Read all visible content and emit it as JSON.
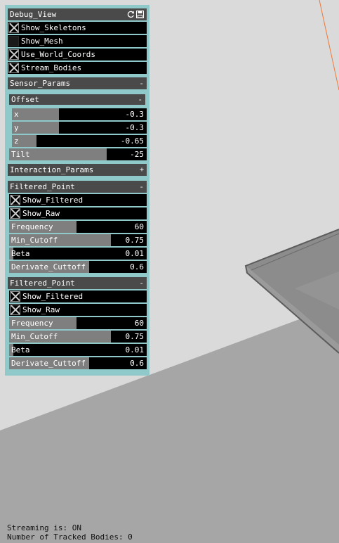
{
  "debug_view": {
    "title": "Debug_View",
    "icons": [
      "refresh-icon",
      "save-icon"
    ],
    "toggles": [
      {
        "label": "Show_Skeletons",
        "checked": true
      },
      {
        "label": "Show_Mesh",
        "checked": false
      },
      {
        "label": "Use_World_Coords",
        "checked": true
      },
      {
        "label": "Stream_Bodies",
        "checked": true
      }
    ]
  },
  "sensor_params": {
    "title": "Sensor_Params",
    "collapse": "-",
    "offset": {
      "title": "Offset",
      "collapse": "-",
      "sliders": [
        {
          "label": "x",
          "value": "-0.3",
          "fraction": 0.35
        },
        {
          "label": "y",
          "value": "-0.3",
          "fraction": 0.35
        },
        {
          "label": "z",
          "value": "-0.65",
          "fraction": 0.18
        }
      ]
    },
    "tilt": {
      "label": "Tilt",
      "value": "-25",
      "fraction": 0.71
    }
  },
  "interaction_params": {
    "title": "Interaction_Params",
    "collapse": "+"
  },
  "filtered_points": [
    {
      "title": "Filtered_Point",
      "collapse": "-",
      "toggles": [
        {
          "label": "Show_Filtered",
          "checked": true
        },
        {
          "label": "Show_Raw",
          "checked": true
        }
      ],
      "sliders": [
        {
          "label": "Frequency",
          "value": "60",
          "fraction": 0.49
        },
        {
          "label": "Min_Cutoff",
          "value": "0.75",
          "fraction": 0.74
        },
        {
          "label": "Beta",
          "value": "0.01",
          "fraction": 0.03
        },
        {
          "label": "Derivate_Cuttoff",
          "value": "0.6",
          "fraction": 0.58
        }
      ]
    },
    {
      "title": "Filtered_Point",
      "collapse": "-",
      "toggles": [
        {
          "label": "Show_Filtered",
          "checked": true
        },
        {
          "label": "Show_Raw",
          "checked": true
        }
      ],
      "sliders": [
        {
          "label": "Frequency",
          "value": "60",
          "fraction": 0.49
        },
        {
          "label": "Min_Cutoff",
          "value": "0.75",
          "fraction": 0.74
        },
        {
          "label": "Beta",
          "value": "0.01",
          "fraction": 0.03
        },
        {
          "label": "Derivate_Cuttoff",
          "value": "0.6",
          "fraction": 0.58
        }
      ]
    }
  ],
  "status": {
    "streaming": "Streaming is: ON",
    "tracked": "Number of Tracked Bodies: 0"
  },
  "colors": {
    "panel_border": "#8fc9c9",
    "header_bg": "#4a4a4a",
    "slider_fill": "#7f7f7f",
    "row_bg": "#000000",
    "scene_floor": "#a6a6a6",
    "scene_wall": "#dadada"
  }
}
